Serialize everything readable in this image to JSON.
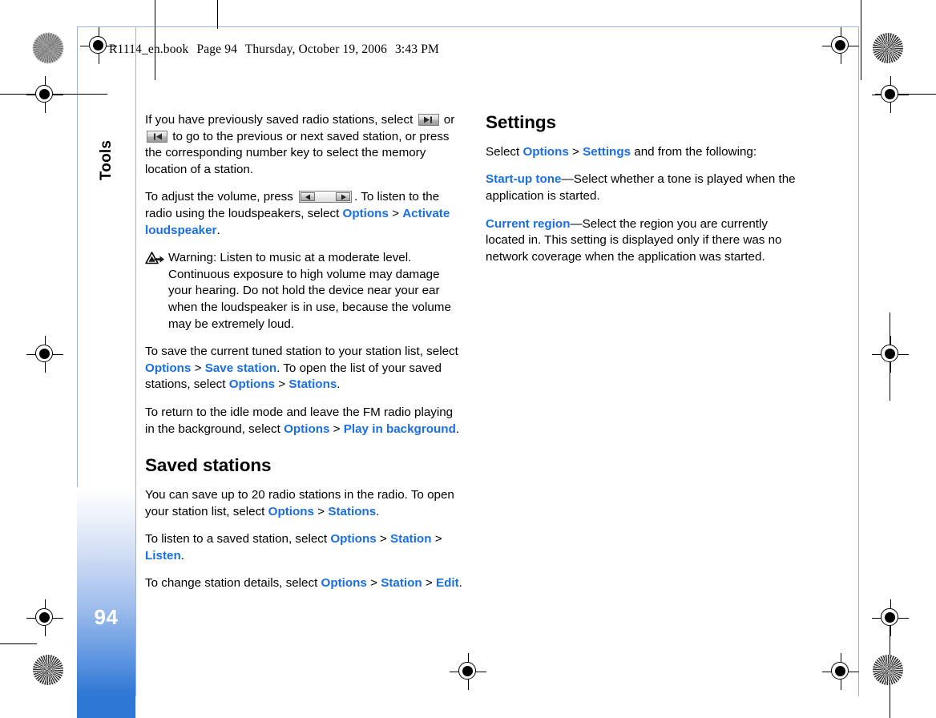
{
  "document": {
    "running_header": {
      "filename": "R1114_en.book",
      "page_label": "Page 94",
      "date": "Thursday, October 19, 2006",
      "time": "3:43 PM"
    },
    "chapter_tab": "Tools",
    "page_number": "94",
    "accent_color": "#1a6fe0",
    "sidebar_color": "#2f77d4"
  },
  "left_column": {
    "p1": {
      "a": "If you have previously saved radio stations, select ",
      "icon_next": "next-track-key-icon",
      "b": " or ",
      "icon_prev": "previous-track-key-icon",
      "c": " to go to the previous or next saved station, or press the corresponding number key to select the memory location of a station."
    },
    "p2": {
      "a": "To adjust the volume, press ",
      "icon_rocker": "volume-rocker-key-icon",
      "b": ". To listen to the radio using the loudspeakers, select ",
      "ui1": "Options",
      "sep1": " > ",
      "ui2": "Activate loudspeaker",
      "c": "."
    },
    "warning": {
      "icon": "warning-triangle-icon",
      "text": "Warning: Listen to music at a moderate level. Continuous exposure to high volume may damage your hearing. Do not hold the device near your ear when the loudspeaker is in use, because the volume may be extremely loud."
    },
    "p3": {
      "a": "To save the current tuned station to your station list, select ",
      "ui1": "Options",
      "sep1": " > ",
      "ui2": "Save station",
      "b": ". To open the list of your saved stations, select ",
      "ui3": "Options",
      "sep2": " > ",
      "ui4": "Stations",
      "c": "."
    },
    "p4": {
      "a": "To return to the idle mode and leave the FM radio playing in the background, select ",
      "ui1": "Options",
      "sep1": " > ",
      "ui2": "Play in background",
      "b": "."
    },
    "heading": "Saved stations",
    "p5": {
      "a": "You can save up to 20 radio stations in the radio. To open your station list, select ",
      "ui1": "Options",
      "sep1": " > ",
      "ui2": "Stations",
      "b": "."
    },
    "p6": {
      "a": "To listen to a saved station, select ",
      "ui1": "Options",
      "sep1": " > ",
      "ui2": "Station",
      "sep2": " > ",
      "ui3": "Listen",
      "b": "."
    },
    "p7": {
      "a": "To change station details, select ",
      "ui1": "Options",
      "sep1": " > ",
      "ui2": "Station",
      "sep2": " > ",
      "ui3": "Edit",
      "b": "."
    }
  },
  "right_column": {
    "heading": "Settings",
    "p1": {
      "a": "Select ",
      "ui1": "Options",
      "sep1": " > ",
      "ui2": "Settings",
      "b": " and from the following:"
    },
    "p2": {
      "ui1": "Start-up tone",
      "a": "—Select whether a tone is played when the application is started."
    },
    "p3": {
      "ui1": "Current region",
      "a": "—Select the region you are currently located in. This setting is displayed only if there was no network coverage when the application was started."
    }
  }
}
